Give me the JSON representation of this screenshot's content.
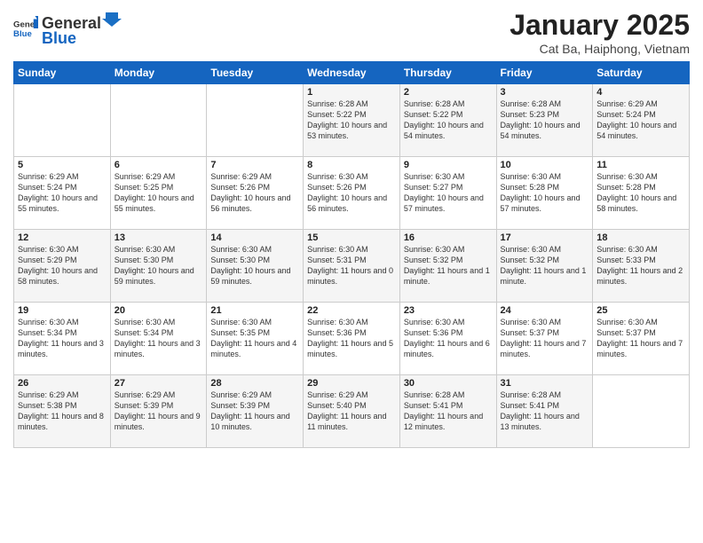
{
  "header": {
    "logo_general": "General",
    "logo_blue": "Blue",
    "title": "January 2025",
    "subtitle": "Cat Ba, Haiphong, Vietnam"
  },
  "weekdays": [
    "Sunday",
    "Monday",
    "Tuesday",
    "Wednesday",
    "Thursday",
    "Friday",
    "Saturday"
  ],
  "weeks": [
    [
      {
        "day": "",
        "info": ""
      },
      {
        "day": "",
        "info": ""
      },
      {
        "day": "",
        "info": ""
      },
      {
        "day": "1",
        "info": "Sunrise: 6:28 AM\nSunset: 5:22 PM\nDaylight: 10 hours and 53 minutes."
      },
      {
        "day": "2",
        "info": "Sunrise: 6:28 AM\nSunset: 5:22 PM\nDaylight: 10 hours and 54 minutes."
      },
      {
        "day": "3",
        "info": "Sunrise: 6:28 AM\nSunset: 5:23 PM\nDaylight: 10 hours and 54 minutes."
      },
      {
        "day": "4",
        "info": "Sunrise: 6:29 AM\nSunset: 5:24 PM\nDaylight: 10 hours and 54 minutes."
      }
    ],
    [
      {
        "day": "5",
        "info": "Sunrise: 6:29 AM\nSunset: 5:24 PM\nDaylight: 10 hours and 55 minutes."
      },
      {
        "day": "6",
        "info": "Sunrise: 6:29 AM\nSunset: 5:25 PM\nDaylight: 10 hours and 55 minutes."
      },
      {
        "day": "7",
        "info": "Sunrise: 6:29 AM\nSunset: 5:26 PM\nDaylight: 10 hours and 56 minutes."
      },
      {
        "day": "8",
        "info": "Sunrise: 6:30 AM\nSunset: 5:26 PM\nDaylight: 10 hours and 56 minutes."
      },
      {
        "day": "9",
        "info": "Sunrise: 6:30 AM\nSunset: 5:27 PM\nDaylight: 10 hours and 57 minutes."
      },
      {
        "day": "10",
        "info": "Sunrise: 6:30 AM\nSunset: 5:28 PM\nDaylight: 10 hours and 57 minutes."
      },
      {
        "day": "11",
        "info": "Sunrise: 6:30 AM\nSunset: 5:28 PM\nDaylight: 10 hours and 58 minutes."
      }
    ],
    [
      {
        "day": "12",
        "info": "Sunrise: 6:30 AM\nSunset: 5:29 PM\nDaylight: 10 hours and 58 minutes."
      },
      {
        "day": "13",
        "info": "Sunrise: 6:30 AM\nSunset: 5:30 PM\nDaylight: 10 hours and 59 minutes."
      },
      {
        "day": "14",
        "info": "Sunrise: 6:30 AM\nSunset: 5:30 PM\nDaylight: 10 hours and 59 minutes."
      },
      {
        "day": "15",
        "info": "Sunrise: 6:30 AM\nSunset: 5:31 PM\nDaylight: 11 hours and 0 minutes."
      },
      {
        "day": "16",
        "info": "Sunrise: 6:30 AM\nSunset: 5:32 PM\nDaylight: 11 hours and 1 minute."
      },
      {
        "day": "17",
        "info": "Sunrise: 6:30 AM\nSunset: 5:32 PM\nDaylight: 11 hours and 1 minute."
      },
      {
        "day": "18",
        "info": "Sunrise: 6:30 AM\nSunset: 5:33 PM\nDaylight: 11 hours and 2 minutes."
      }
    ],
    [
      {
        "day": "19",
        "info": "Sunrise: 6:30 AM\nSunset: 5:34 PM\nDaylight: 11 hours and 3 minutes."
      },
      {
        "day": "20",
        "info": "Sunrise: 6:30 AM\nSunset: 5:34 PM\nDaylight: 11 hours and 3 minutes."
      },
      {
        "day": "21",
        "info": "Sunrise: 6:30 AM\nSunset: 5:35 PM\nDaylight: 11 hours and 4 minutes."
      },
      {
        "day": "22",
        "info": "Sunrise: 6:30 AM\nSunset: 5:36 PM\nDaylight: 11 hours and 5 minutes."
      },
      {
        "day": "23",
        "info": "Sunrise: 6:30 AM\nSunset: 5:36 PM\nDaylight: 11 hours and 6 minutes."
      },
      {
        "day": "24",
        "info": "Sunrise: 6:30 AM\nSunset: 5:37 PM\nDaylight: 11 hours and 7 minutes."
      },
      {
        "day": "25",
        "info": "Sunrise: 6:30 AM\nSunset: 5:37 PM\nDaylight: 11 hours and 7 minutes."
      }
    ],
    [
      {
        "day": "26",
        "info": "Sunrise: 6:29 AM\nSunset: 5:38 PM\nDaylight: 11 hours and 8 minutes."
      },
      {
        "day": "27",
        "info": "Sunrise: 6:29 AM\nSunset: 5:39 PM\nDaylight: 11 hours and 9 minutes."
      },
      {
        "day": "28",
        "info": "Sunrise: 6:29 AM\nSunset: 5:39 PM\nDaylight: 11 hours and 10 minutes."
      },
      {
        "day": "29",
        "info": "Sunrise: 6:29 AM\nSunset: 5:40 PM\nDaylight: 11 hours and 11 minutes."
      },
      {
        "day": "30",
        "info": "Sunrise: 6:28 AM\nSunset: 5:41 PM\nDaylight: 11 hours and 12 minutes."
      },
      {
        "day": "31",
        "info": "Sunrise: 6:28 AM\nSunset: 5:41 PM\nDaylight: 11 hours and 13 minutes."
      },
      {
        "day": "",
        "info": ""
      }
    ]
  ]
}
